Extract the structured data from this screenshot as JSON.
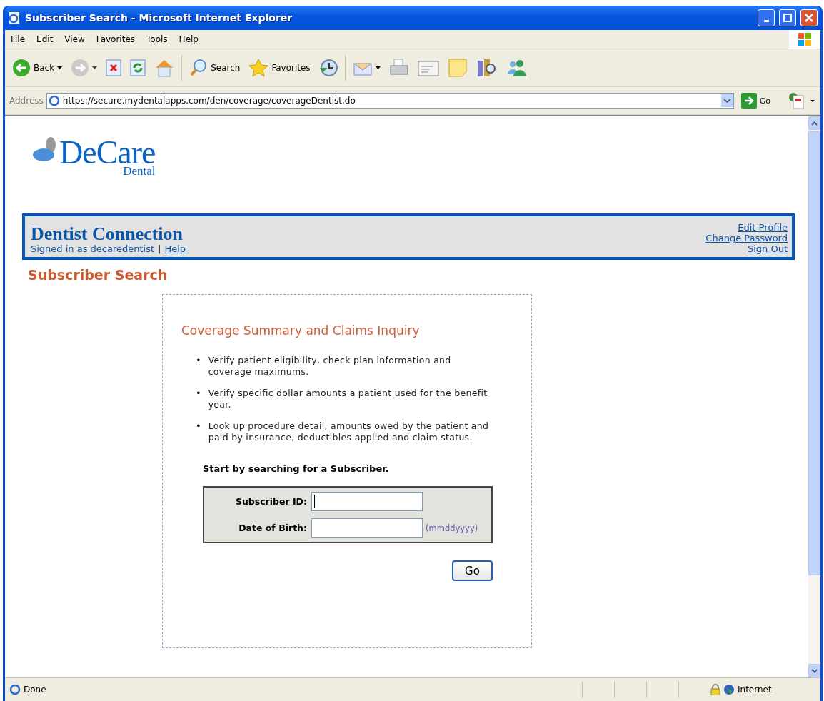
{
  "window": {
    "title": "Subscriber Search - Microsoft Internet Explorer"
  },
  "menu": [
    "File",
    "Edit",
    "View",
    "Favorites",
    "Tools",
    "Help"
  ],
  "toolbar": [
    {
      "label": "Back",
      "dropdown": true,
      "disabled": false
    },
    {
      "dropdown": true,
      "disabled": true
    },
    {
      "dropdown": false,
      "disabled": false
    },
    {
      "dropdown": false,
      "disabled": false
    },
    {
      "dropdown": false,
      "disabled": false
    },
    {
      "label": "Search",
      "dropdown": false,
      "disabled": false
    },
    {
      "label": "Favorites",
      "dropdown": false,
      "disabled": false
    },
    {
      "dropdown": false,
      "disabled": false
    },
    {
      "dropdown": true,
      "disabled": false
    },
    {
      "dropdown": false,
      "disabled": false
    },
    {
      "dropdown": false,
      "disabled": false
    },
    {
      "dropdown": false,
      "disabled": false
    },
    {
      "dropdown": false,
      "disabled": false
    },
    {
      "dropdown": false,
      "disabled": false
    }
  ],
  "address": {
    "label": "Address",
    "url": "https://secure.mydentalapps.com/den/coverage/coverageDentist.do",
    "go": "Go"
  },
  "page": {
    "logo": {
      "brand": "DeCare",
      "sub": "Dental"
    },
    "header": {
      "title": "Dentist Connection",
      "signed_in": "Signed in as decaredentist",
      "separator": "|",
      "help": "Help",
      "links": [
        "Edit Profile",
        "Change Password",
        "Sign Out"
      ]
    },
    "title": "Subscriber Search",
    "card": {
      "title": "Coverage Summary and Claims Inquiry",
      "bullets": [
        {
          "marker": "•",
          "text": "Verify patient eligibility, check plan information and coverage maximums."
        },
        {
          "marker": "•",
          "text": "Verify specific dollar amounts a patient used for the benefit year."
        },
        {
          "marker": "•",
          "text": "Look up procedure detail, amounts owed by the patient and paid by insurance, deductibles applied and claim status."
        }
      ],
      "prompt": "Start by searching for a Subscriber.",
      "fields": [
        {
          "label": "Subscriber ID:",
          "focused": true
        },
        {
          "label": "Date of Birth:",
          "focused": false,
          "hint": "(mmddyyyy)"
        }
      ],
      "button": "Go"
    }
  },
  "status": {
    "text": "Done",
    "zone": "Internet"
  }
}
